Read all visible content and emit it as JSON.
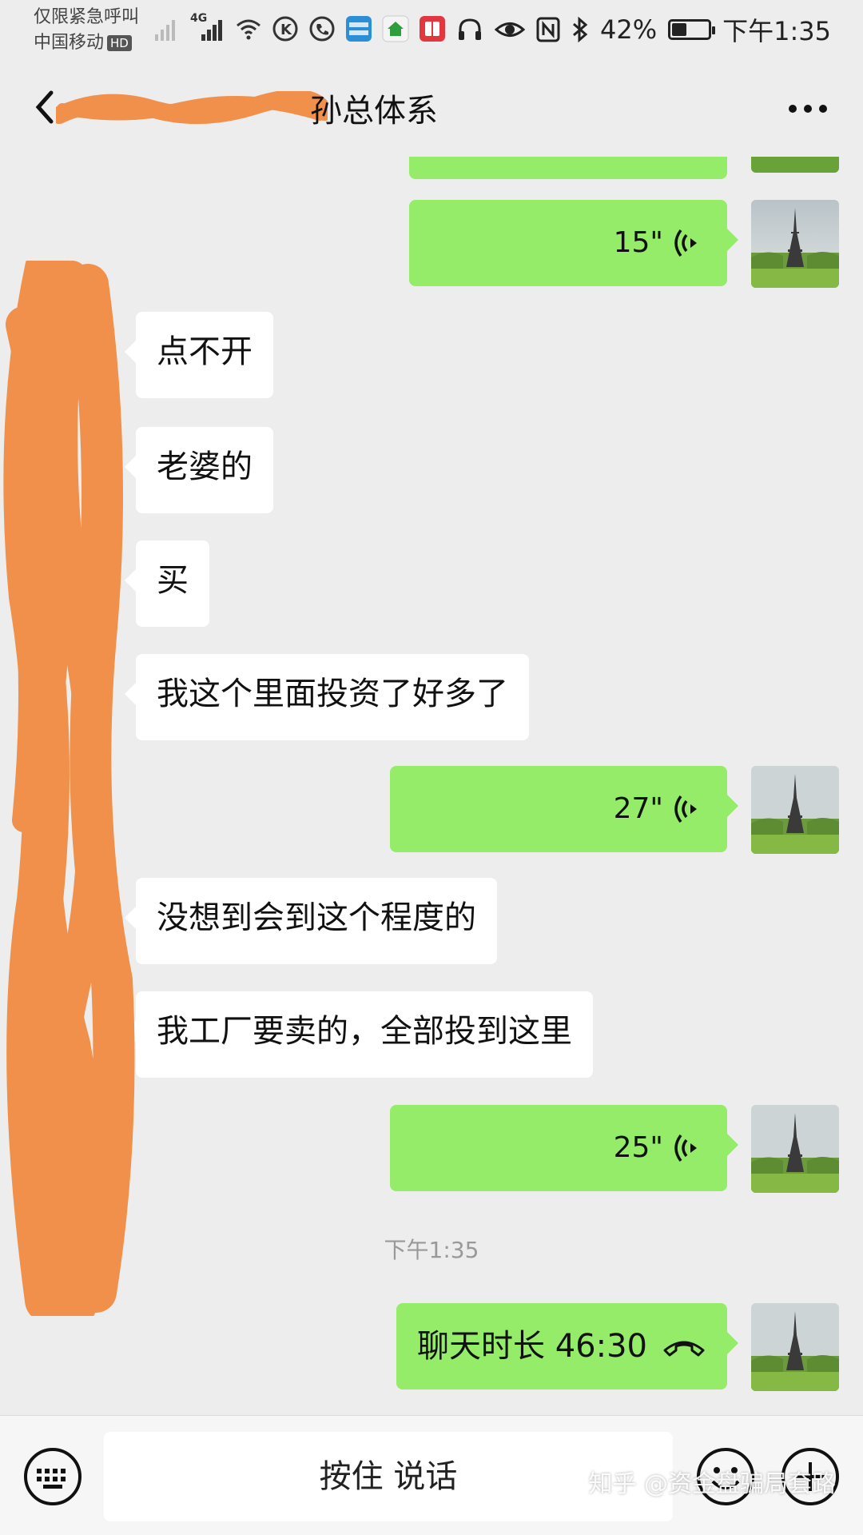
{
  "status_bar": {
    "carrier_line1": "仅限紧急呼叫",
    "carrier_line2": "中国移动",
    "hd": "HD",
    "network": "4G",
    "battery": "42%",
    "battery_level": 0.42,
    "time": "下午1:35"
  },
  "header": {
    "title": "孙总体系"
  },
  "messages": [
    {
      "side": "out",
      "type": "voice",
      "duration": "15\""
    },
    {
      "side": "in",
      "type": "text",
      "text": "点不开"
    },
    {
      "side": "in",
      "type": "text",
      "text": "老婆的"
    },
    {
      "side": "in",
      "type": "text",
      "text": "买"
    },
    {
      "side": "in",
      "type": "text",
      "text": "我这个里面投资了好多了"
    },
    {
      "side": "out",
      "type": "voice",
      "duration": "27\""
    },
    {
      "side": "in",
      "type": "text",
      "text": "没想到会到这个程度的"
    },
    {
      "side": "in",
      "type": "text",
      "text": "我工厂要卖的，全部投到这里"
    },
    {
      "side": "out",
      "type": "voice",
      "duration": "25\""
    },
    {
      "side": "out",
      "type": "call",
      "text": "聊天时长 46:30"
    }
  ],
  "chat_timestamp": "下午1:35",
  "input_bar": {
    "hold_to_talk": "按住 说话"
  },
  "watermark": "知乎 @资金盘骗局套路",
  "colors": {
    "background": "#ededed",
    "outgoing_bubble": "#95ec69",
    "incoming_bubble": "#ffffff",
    "redaction": "#f0904a"
  }
}
